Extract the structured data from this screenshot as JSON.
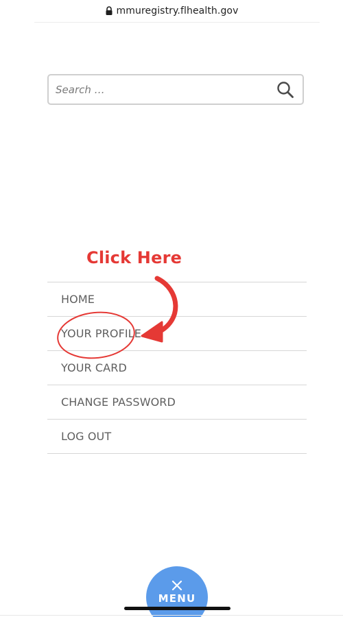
{
  "browser": {
    "url": "mmuregistry.flhealth.gov",
    "lock_icon": "lock-icon"
  },
  "search": {
    "placeholder": "Search …",
    "value": "",
    "icon": "search-icon"
  },
  "annotation": {
    "text": "Click Here",
    "color": "#e53935",
    "target": "YOUR PROFILE"
  },
  "menu": {
    "items": [
      {
        "label": "HOME"
      },
      {
        "label": "YOUR PROFILE"
      },
      {
        "label": "YOUR CARD"
      },
      {
        "label": "CHANGE PASSWORD"
      },
      {
        "label": "LOG OUT"
      }
    ]
  },
  "menu_button": {
    "label": "MENU",
    "icon": "close-icon",
    "color": "#5b9bea"
  }
}
